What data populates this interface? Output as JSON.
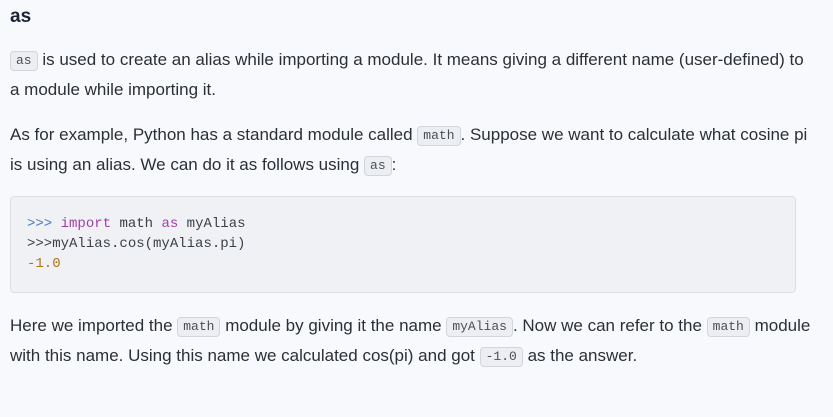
{
  "heading": "as",
  "para1": {
    "code_as": "as",
    "text_a": " is used to create an alias while importing a module. It means giving a different name (user-defined) to a module while importing it."
  },
  "para2": {
    "text_a": "As for example, Python has a standard module called ",
    "code_math": "math",
    "text_b": ". Suppose we want to calculate what cosine pi is using an alias. We can do it as follows using ",
    "code_as": "as",
    "text_c": ":"
  },
  "codeblock": {
    "line1": {
      "prompt": ">>>",
      "space": " ",
      "kw_import": "import",
      "mid": " math ",
      "kw_as": "as",
      "tail": " myAlias"
    },
    "line2": {
      "prompt": ">>>",
      "tail": "myAlias.cos(myAlias.pi)"
    },
    "line3": {
      "value": "-1.0"
    }
  },
  "para3": {
    "text_a": "Here we imported the ",
    "code_math": "math",
    "text_b": " module by giving it the name ",
    "code_alias": "myAlias",
    "text_c": ". Now we can refer to the ",
    "code_math2": "math",
    "text_d": " module with this name. Using this name we calculated cos(pi) and got ",
    "code_val": "-1.0",
    "text_e": " as the answer."
  }
}
